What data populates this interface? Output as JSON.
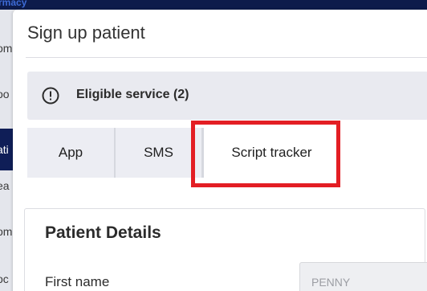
{
  "background": {
    "header_text": "rmacy",
    "sidebar_items": [
      "om",
      "oo",
      "ati",
      "ea",
      "om",
      "oc"
    ]
  },
  "modal": {
    "title": "Sign up patient",
    "banner": {
      "icon": "info-circle-icon",
      "text": "Eligible service (2)"
    },
    "tabs": [
      {
        "label": "App",
        "active": false
      },
      {
        "label": "SMS",
        "active": false
      },
      {
        "label": "Script tracker",
        "active": true
      }
    ],
    "patient_details": {
      "title": "Patient Details",
      "first_name": {
        "label": "First name",
        "value": "PENNY"
      }
    }
  },
  "colors": {
    "highlight": "#e31e24",
    "nav_dark": "#0d1b4b"
  }
}
